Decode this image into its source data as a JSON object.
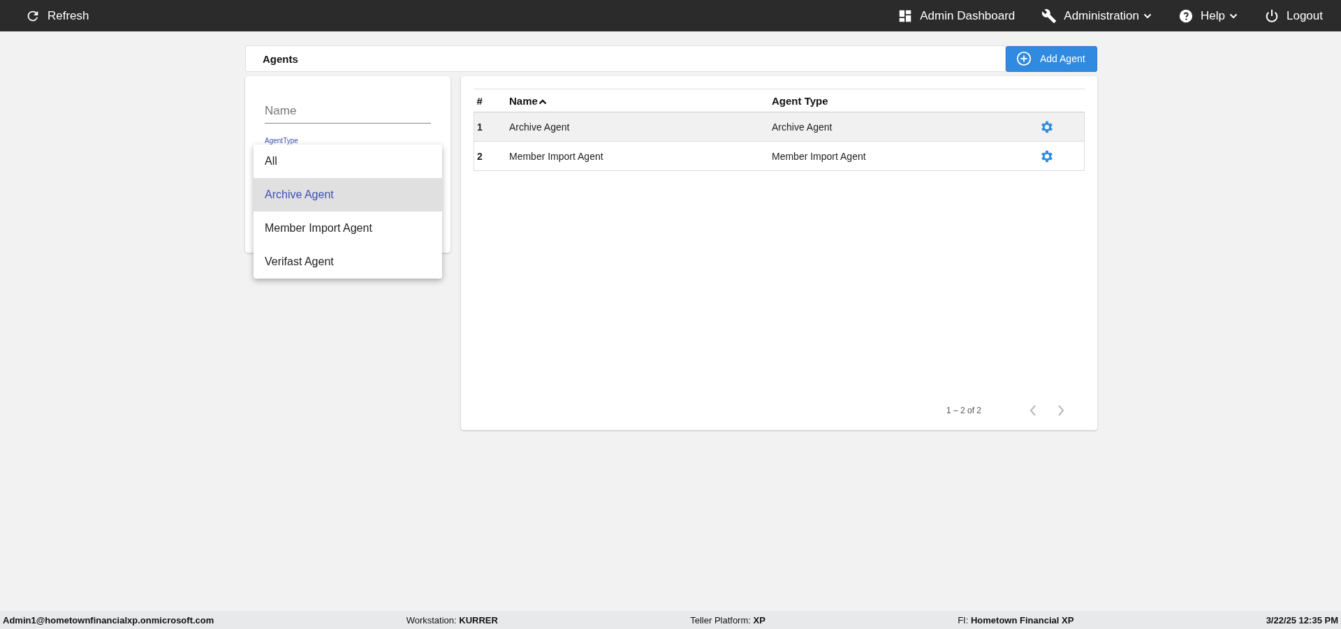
{
  "top_bar": {
    "refresh": {
      "label": "Refresh"
    },
    "nav": [
      {
        "label": "Admin Dashboard",
        "has_menu": false
      },
      {
        "label": "Administration",
        "has_menu": true
      },
      {
        "label": "Help",
        "has_menu": true
      },
      {
        "label": "Logout",
        "has_menu": false
      }
    ]
  },
  "header": {
    "title": "Agents",
    "add_button": "Add Agent"
  },
  "filters": {
    "name_field": {
      "placeholder": "Name"
    },
    "type_label": "AgentType",
    "type_menu": [
      {
        "label": "All",
        "selected": false
      },
      {
        "label": "Archive Agent",
        "selected": true
      },
      {
        "label": "Member Import Agent",
        "selected": false
      },
      {
        "label": "Verifast Agent",
        "selected": false
      }
    ]
  },
  "table": {
    "columns": [
      {
        "label": "#",
        "sorted_ascending": false
      },
      {
        "label": "Name",
        "sorted_ascending": true
      },
      {
        "label": "Agent Type",
        "sorted_ascending": false
      }
    ],
    "rows": [
      {
        "cells": [
          "1",
          "Archive Agent",
          "Archive Agent"
        ],
        "highlighted": true
      },
      {
        "cells": [
          "2",
          "Member Import Agent",
          "Member Import Agent"
        ],
        "highlighted": false
      }
    ],
    "pagination": {
      "range": "1 – 2 of 2",
      "prev_disabled": true,
      "next_disabled": true
    }
  },
  "status_bar": [
    {
      "text": "Admin1@hometownfinancialxp.onmicrosoft.com",
      "bold": true
    },
    {
      "text": "Workstation: **KURRER**",
      "bold": false
    },
    {
      "text": "Teller Platform: **XP**",
      "bold": false
    },
    {
      "text": "FI: **Hometown Financial XP**",
      "bold": false
    },
    {
      "text": "3/22/25 12:35 PM",
      "bold": true
    }
  ]
}
